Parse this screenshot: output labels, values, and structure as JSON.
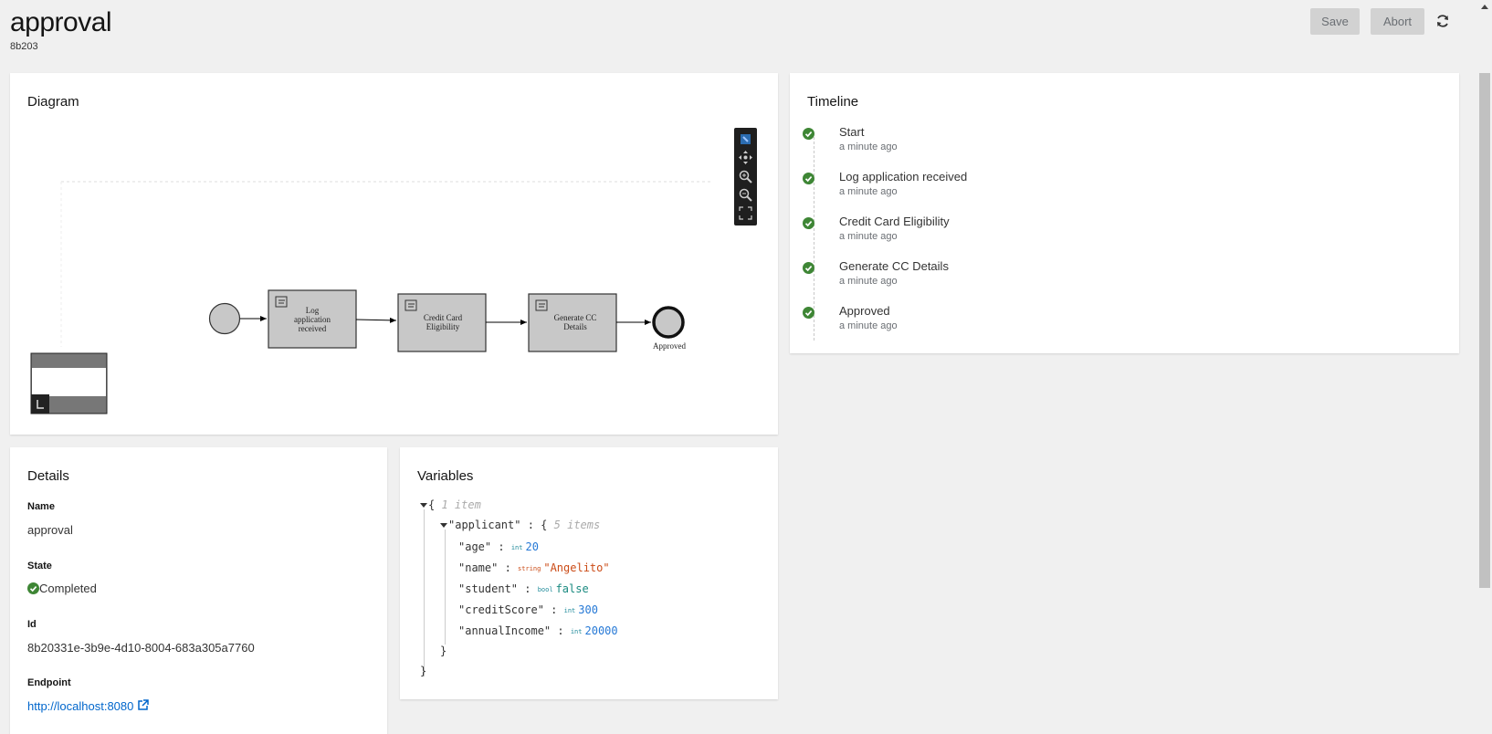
{
  "header": {
    "title": "approval",
    "subtitle": "8b203",
    "save_label": "Save",
    "abort_label": "Abort",
    "refresh_icon": "refresh-icon"
  },
  "diagram": {
    "title": "Diagram",
    "nodes": {
      "task1_line1": "Log",
      "task1_line2": "application",
      "task1_line3": "received",
      "task2_line1": "Credit Card",
      "task2_line2": "Eligibility",
      "task3_line1": "Generate CC",
      "task3_line2": "Details",
      "end_label": "Approved"
    }
  },
  "timeline": {
    "title": "Timeline",
    "items": [
      {
        "label": "Start",
        "time": "a minute ago"
      },
      {
        "label": "Log application received",
        "time": "a minute ago"
      },
      {
        "label": "Credit Card Eligibility",
        "time": "a minute ago"
      },
      {
        "label": "Generate CC Details",
        "time": "a minute ago"
      },
      {
        "label": "Approved",
        "time": "a minute ago"
      }
    ]
  },
  "details": {
    "title": "Details",
    "name_label": "Name",
    "name_value": "approval",
    "state_label": "State",
    "state_value": "Completed",
    "id_label": "Id",
    "id_value": "8b20331e-3b9e-4d10-8004-683a305a7760",
    "endpoint_label": "Endpoint",
    "endpoint_value": "http://localhost:8080"
  },
  "variables": {
    "title": "Variables",
    "root_open": "{",
    "root_meta": "1 item",
    "applicant_key": "\"applicant\"",
    "applicant_meta": "5 items",
    "age_key": "\"age\"",
    "age_type": "int",
    "age_value": "20",
    "name_key": "\"name\"",
    "name_type": "string",
    "name_value": "\"Angelito\"",
    "student_key": "\"student\"",
    "student_type": "bool",
    "student_value": "false",
    "creditScore_key": "\"creditScore\"",
    "creditScore_type": "int",
    "creditScore_value": "300",
    "annualIncome_key": "\"annualIncome\"",
    "annualIncome_type": "int",
    "annualIncome_value": "20000"
  },
  "colors": {
    "success": "#3e8635",
    "link": "#0066cc",
    "node_fill": "#c8c8c8"
  }
}
